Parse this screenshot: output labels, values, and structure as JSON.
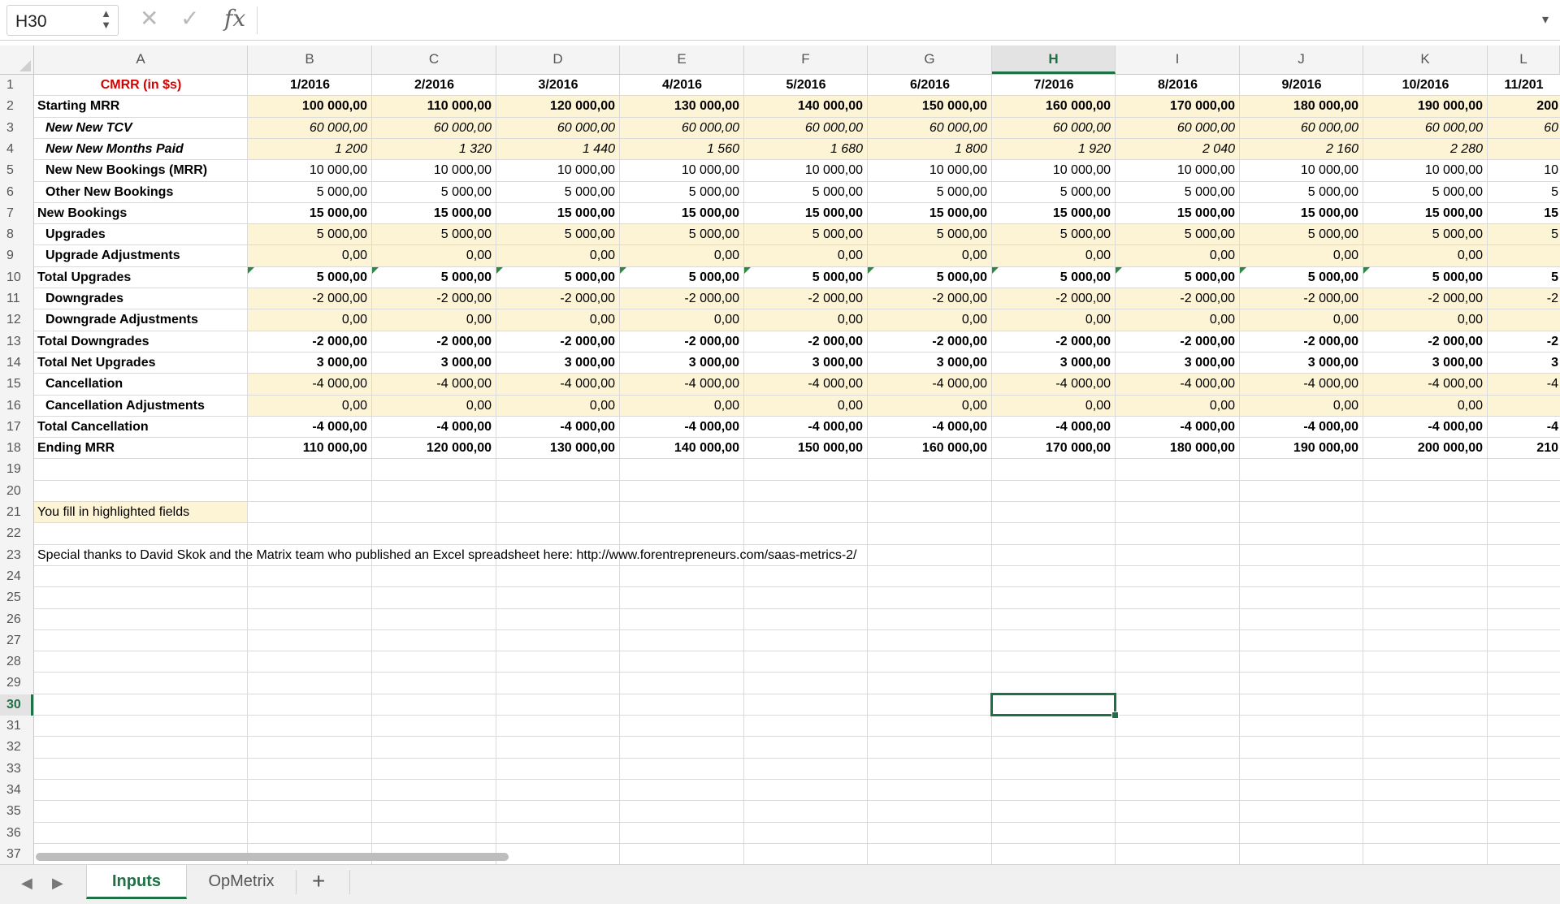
{
  "formula_bar": {
    "name_box": "H30",
    "stepper": "▲\n▼",
    "cancel_icon": "✕",
    "confirm_icon": "✓",
    "fx_label": "fx",
    "formula_value": "",
    "expand_icon": "▾"
  },
  "columns": [
    "A",
    "B",
    "C",
    "D",
    "E",
    "F",
    "G",
    "H",
    "I",
    "J",
    "K",
    "L"
  ],
  "selected_column": "H",
  "selected_row": 30,
  "rows": [
    1,
    2,
    3,
    4,
    5,
    6,
    7,
    8,
    9,
    10,
    11,
    12,
    13,
    14,
    15,
    16,
    17,
    18,
    19,
    20,
    21,
    22,
    23,
    24,
    25,
    26,
    27,
    28,
    29,
    30,
    31,
    32,
    33,
    34,
    35,
    36,
    37
  ],
  "sheet": {
    "title": "CMRR (in $s)",
    "months": [
      "1/2016",
      "2/2016",
      "3/2016",
      "4/2016",
      "5/2016",
      "6/2016",
      "7/2016",
      "8/2016",
      "9/2016",
      "10/2016",
      "11/201"
    ],
    "line_items": [
      {
        "label": "Starting MRR",
        "style": "bold",
        "values": [
          "100 000,00",
          "110 000,00",
          "120 000,00",
          "130 000,00",
          "140 000,00",
          "150 000,00",
          "160 000,00",
          "170 000,00",
          "180 000,00",
          "190 000,00",
          "200"
        ]
      },
      {
        "label": "New New TCV",
        "style": "italic",
        "values": [
          "60 000,00",
          "60 000,00",
          "60 000,00",
          "60 000,00",
          "60 000,00",
          "60 000,00",
          "60 000,00",
          "60 000,00",
          "60 000,00",
          "60 000,00",
          "60"
        ]
      },
      {
        "label": "New New Months Paid",
        "style": "italic",
        "values": [
          "1 200",
          "1 320",
          "1 440",
          "1 560",
          "1 680",
          "1 800",
          "1 920",
          "2 040",
          "2 160",
          "2 280",
          ""
        ]
      },
      {
        "label": "New New Bookings (MRR)",
        "style": "indent",
        "values": [
          "10 000,00",
          "10 000,00",
          "10 000,00",
          "10 000,00",
          "10 000,00",
          "10 000,00",
          "10 000,00",
          "10 000,00",
          "10 000,00",
          "10 000,00",
          "10"
        ]
      },
      {
        "label": "Other New Bookings",
        "style": "indent",
        "values": [
          "5 000,00",
          "5 000,00",
          "5 000,00",
          "5 000,00",
          "5 000,00",
          "5 000,00",
          "5 000,00",
          "5 000,00",
          "5 000,00",
          "5 000,00",
          "5"
        ]
      },
      {
        "label": "New Bookings",
        "style": "bold",
        "values": [
          "15 000,00",
          "15 000,00",
          "15 000,00",
          "15 000,00",
          "15 000,00",
          "15 000,00",
          "15 000,00",
          "15 000,00",
          "15 000,00",
          "15 000,00",
          "15"
        ]
      },
      {
        "label": "Upgrades",
        "style": "indent",
        "values": [
          "5 000,00",
          "5 000,00",
          "5 000,00",
          "5 000,00",
          "5 000,00",
          "5 000,00",
          "5 000,00",
          "5 000,00",
          "5 000,00",
          "5 000,00",
          "5"
        ]
      },
      {
        "label": "Upgrade Adjustments",
        "style": "indent",
        "values": [
          "0,00",
          "0,00",
          "0,00",
          "0,00",
          "0,00",
          "0,00",
          "0,00",
          "0,00",
          "0,00",
          "0,00",
          ""
        ]
      },
      {
        "label": "Total Upgrades",
        "style": "bold",
        "values": [
          "5 000,00",
          "5 000,00",
          "5 000,00",
          "5 000,00",
          "5 000,00",
          "5 000,00",
          "5 000,00",
          "5 000,00",
          "5 000,00",
          "5 000,00",
          "5"
        ]
      },
      {
        "label": "Downgrades",
        "style": "indent",
        "values": [
          "-2 000,00",
          "-2 000,00",
          "-2 000,00",
          "-2 000,00",
          "-2 000,00",
          "-2 000,00",
          "-2 000,00",
          "-2 000,00",
          "-2 000,00",
          "-2 000,00",
          "-2"
        ]
      },
      {
        "label": "Downgrade Adjustments",
        "style": "indent",
        "values": [
          "0,00",
          "0,00",
          "0,00",
          "0,00",
          "0,00",
          "0,00",
          "0,00",
          "0,00",
          "0,00",
          "0,00",
          ""
        ]
      },
      {
        "label": "Total Downgrades",
        "style": "bold",
        "values": [
          "-2 000,00",
          "-2 000,00",
          "-2 000,00",
          "-2 000,00",
          "-2 000,00",
          "-2 000,00",
          "-2 000,00",
          "-2 000,00",
          "-2 000,00",
          "-2 000,00",
          "-2"
        ]
      },
      {
        "label": "Total Net Upgrades",
        "style": "bold",
        "values": [
          "3 000,00",
          "3 000,00",
          "3 000,00",
          "3 000,00",
          "3 000,00",
          "3 000,00",
          "3 000,00",
          "3 000,00",
          "3 000,00",
          "3 000,00",
          "3"
        ]
      },
      {
        "label": "Cancellation",
        "style": "indent",
        "values": [
          "-4 000,00",
          "-4 000,00",
          "-4 000,00",
          "-4 000,00",
          "-4 000,00",
          "-4 000,00",
          "-4 000,00",
          "-4 000,00",
          "-4 000,00",
          "-4 000,00",
          "-4"
        ]
      },
      {
        "label": "Cancellation Adjustments",
        "style": "indent",
        "values": [
          "0,00",
          "0,00",
          "0,00",
          "0,00",
          "0,00",
          "0,00",
          "0,00",
          "0,00",
          "0,00",
          "0,00",
          ""
        ]
      },
      {
        "label": "Total Cancellation",
        "style": "bold",
        "values": [
          "-4 000,00",
          "-4 000,00",
          "-4 000,00",
          "-4 000,00",
          "-4 000,00",
          "-4 000,00",
          "-4 000,00",
          "-4 000,00",
          "-4 000,00",
          "-4 000,00",
          "-4"
        ]
      },
      {
        "label": "Ending MRR",
        "style": "bold",
        "values": [
          "110 000,00",
          "120 000,00",
          "130 000,00",
          "140 000,00",
          "150 000,00",
          "160 000,00",
          "170 000,00",
          "180 000,00",
          "190 000,00",
          "200 000,00",
          "210"
        ]
      }
    ],
    "note": "You fill in highlighted fields",
    "credit": "Special thanks to David Skok and the Matrix team who published an Excel spreadsheet here: http://www.forentrepreneurs.com/saas-metrics-2/"
  },
  "tabs": {
    "prev_icon": "◀",
    "next_icon": "▶",
    "items": [
      "Inputs",
      "OpMetrix"
    ],
    "active": "Inputs",
    "add_icon": "+"
  },
  "colors": {
    "highlight": "#fdf3d5",
    "accent_green": "#1e7145",
    "title_red": "#d40000"
  }
}
